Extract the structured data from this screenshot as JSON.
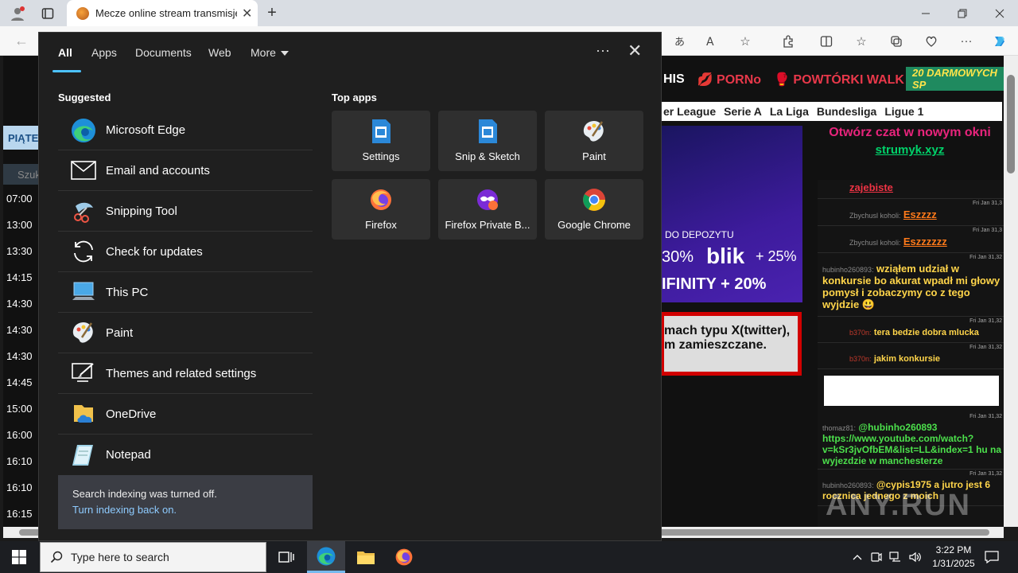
{
  "browser": {
    "tab_title": "Mecze online stream transmisje",
    "tab_close": "✕",
    "new_tab": "+"
  },
  "webpage": {
    "menu_items": [
      "HIS",
      "PORNo",
      "POWTÓRKI WALK"
    ],
    "promo": "20 DARMOWYCH SP",
    "leagues": [
      "er League",
      "Serie A",
      "La Liga",
      "Bundesliga",
      "Ligue 1"
    ],
    "day": "PIĄTE",
    "search_hint": "Szuk",
    "times": [
      "07:00",
      "13:00",
      "13:30",
      "14:15",
      "14:30",
      "14:30",
      "14:30",
      "14:45",
      "15:00",
      "16:00",
      "16:10",
      "16:10",
      "16:15"
    ],
    "banner": {
      "deposit": "DO DEPOZYTU",
      "pct1": "30%",
      "blik": "blik",
      "pct2": "+ 25%",
      "inf": "IFINITY + 20%"
    },
    "notice": "mach typu X(twitter), m zamieszczane.",
    "chat_header": {
      "line1": "Otwórz czat w nowym okni",
      "line2": "strumyk.xyz"
    },
    "chat_messages": [
      {
        "ts": "Fri Jan 31,3",
        "user": "",
        "text": "zajebiste"
      },
      {
        "ts": "Fri Jan 31,3",
        "user": "Zbychusl koholi:",
        "text": "Eszzzz"
      },
      {
        "ts": "Fri Jan 31,3",
        "user": "Zbychusl koholi:",
        "text": "Eszzzzzz"
      },
      {
        "ts": "Fri Jan 31,32",
        "user": "hubinho260893:",
        "text": "wziąłem udział w konkursie bo akurat wpadł mi głowy pomysł i zobaczymy co z tego wyjdzie 😃"
      },
      {
        "ts": "Fri Jan 31,32",
        "user": "b370n:",
        "text": "tera bedzie dobra mlucka"
      },
      {
        "ts": "Fri Jan 31,32",
        "user": "b370n:",
        "text": "jakim konkursie"
      },
      {
        "ts": "Fri Jan 31,32",
        "user": "thomaz81:",
        "text": "@hubinho260893 https://www.youtube.com/watch?v=kSr3jvOfbEM&list=LL&index=1 hu na wyjezdzie w manchesterze"
      },
      {
        "ts": "Fri Jan 31,32",
        "user": "hubinho260893:",
        "text": "@cypis1975 a jutro jest 6 rocznica jednego z moich"
      }
    ]
  },
  "search_panel": {
    "tabs": [
      {
        "label": "All",
        "active": true
      },
      {
        "label": "Apps",
        "active": false
      },
      {
        "label": "Documents",
        "active": false
      },
      {
        "label": "Web",
        "active": false
      },
      {
        "label": "More",
        "active": false
      }
    ],
    "more_options": "···",
    "close": "✕",
    "suggested_title": "Suggested",
    "suggested": [
      {
        "label": "Microsoft Edge",
        "icon": "edge-icon"
      },
      {
        "label": "Email and accounts",
        "icon": "mail-icon"
      },
      {
        "label": "Snipping Tool",
        "icon": "scissors-icon"
      },
      {
        "label": "Check for updates",
        "icon": "refresh-icon"
      },
      {
        "label": "This PC",
        "icon": "computer-icon"
      },
      {
        "label": "Paint",
        "icon": "palette-icon"
      },
      {
        "label": "Themes and related settings",
        "icon": "themes-icon"
      },
      {
        "label": "OneDrive",
        "icon": "onedrive-icon"
      },
      {
        "label": "Notepad",
        "icon": "notepad-icon"
      }
    ],
    "indexing": {
      "message": "Search indexing was turned off.",
      "link": "Turn indexing back on."
    },
    "top_apps_title": "Top apps",
    "top_apps": [
      {
        "label": "Settings",
        "icon": "settings-icon"
      },
      {
        "label": "Snip & Sketch",
        "icon": "snip-sketch-icon"
      },
      {
        "label": "Paint",
        "icon": "palette-icon"
      },
      {
        "label": "Firefox",
        "icon": "firefox-icon"
      },
      {
        "label": "Firefox Private B...",
        "icon": "firefox-private-icon"
      },
      {
        "label": "Google Chrome",
        "icon": "chrome-icon"
      }
    ]
  },
  "taskbar": {
    "search_placeholder": "Type here to search",
    "time": "3:22 PM",
    "date": "1/31/2025"
  },
  "watermark": "ANY.RUN"
}
